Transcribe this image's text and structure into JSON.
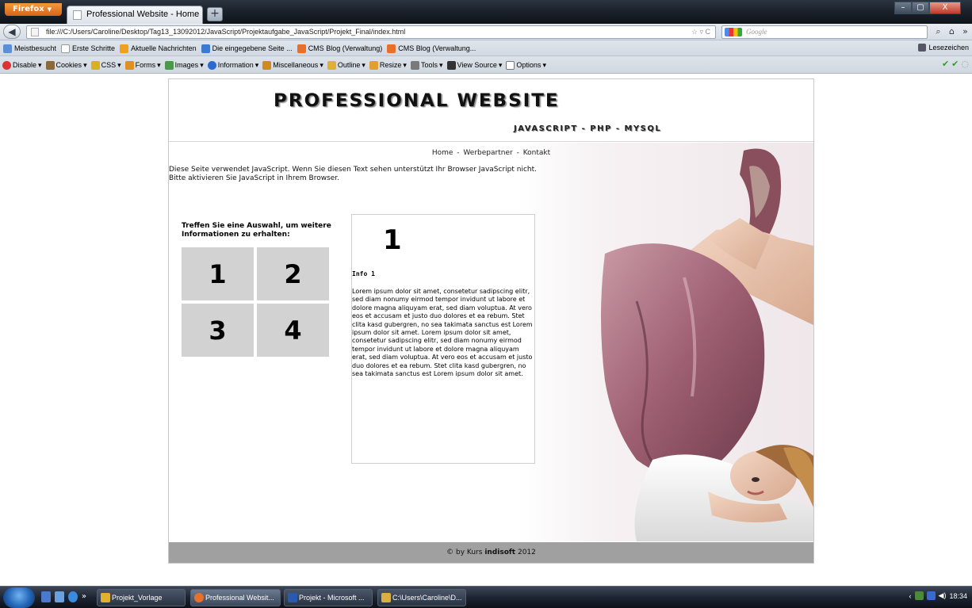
{
  "browser": {
    "menu_button": "Firefox",
    "tab_title": "Professional Website - Home",
    "new_tab": "+",
    "url": "file:///C:/Users/Caroline/Desktop/Tag13_13092012/JavaScript/Projektaufgabe_JavaScript/Projekt_Final/index.html",
    "search_placeholder": "Google",
    "window_controls": [
      "–",
      "▢",
      "X"
    ]
  },
  "bookmarks": {
    "items": [
      "Meistbesucht",
      "Erste Schritte",
      "Aktuelle Nachrichten",
      "Die eingegebene Seite ...",
      "CMS Blog (Verwaltung)",
      "CMS Blog (Verwaltung..."
    ],
    "right": "Lesezeichen"
  },
  "webdev_toolbar": {
    "items": [
      "Disable",
      "Cookies",
      "CSS",
      "Forms",
      "Images",
      "Information",
      "Miscellaneous",
      "Outline",
      "Resize",
      "Tools",
      "View Source",
      "Options"
    ]
  },
  "site": {
    "logo": "PROFESSIONAL WEBSITE",
    "slogan": "JAVASCRIPT - PHP - MYSQL",
    "nav": [
      "Home",
      "Werbepartner",
      "Kontakt"
    ],
    "nav_sep": "-",
    "js_note_line1": "Diese Seite verwendet JavaScript. Wenn Sie diesen Text sehen unterstützt Ihr Browser JavaScript nicht.",
    "js_note_line2": "Bitte aktivieren Sie JavaScript in Ihrem Browser.",
    "pick_label": "Treffen Sie eine Auswahl, um weitere Informationen zu erhalten:",
    "grid": [
      "1",
      "2",
      "3",
      "4"
    ],
    "info_number": "1",
    "info_title": "Info 1",
    "info_text": "Lorem ipsum dolor sit amet, consetetur sadipscing elitr, sed diam nonumy eirmod tempor invidunt ut labore et dolore magna aliquyam erat, sed diam voluptua. At vero eos et accusam et justo duo dolores et ea rebum. Stet clita kasd gubergren, no sea takimata sanctus est Lorem ipsum dolor sit amet. Lorem ipsum dolor sit amet, consetetur sadipscing elitr, sed diam nonumy eirmod tempor invidunt ut labore et dolore magna aliquyam erat, sed diam voluptua. At vero eos et accusam et justo duo dolores et ea rebum. Stet clita kasd gubergren, no sea takimata sanctus est Lorem ipsum dolor sit amet.",
    "footer_prefix": "© by Kurs",
    "footer_brand": "indisoft",
    "footer_year": "2012"
  },
  "taskbar": {
    "items": [
      "Projekt_Vorlage",
      "Professional Websit...",
      "Projekt - Microsoft ...",
      "C:\\Users\\Caroline\\D..."
    ],
    "clock": "18:34"
  }
}
